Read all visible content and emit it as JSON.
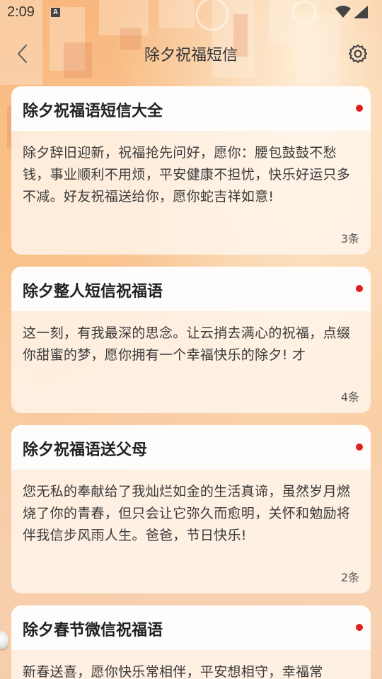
{
  "status_bar": {
    "time": "2:09",
    "notification_icon": "A"
  },
  "app_bar": {
    "title": "除夕祝福短信",
    "back_icon": "chevron-left-icon",
    "settings_icon": "gear-icon"
  },
  "cards": [
    {
      "title": "除夕祝福语短信大全",
      "text": "除夕辞旧迎新，祝福抢先问好，愿你：腰包鼓鼓不愁钱，事业顺利不用烦，平安健康不担忧，快乐好运只多不减。好友祝福送给你，愿你蛇吉祥如意!",
      "count": "3条"
    },
    {
      "title": "除夕整人短信祝福语",
      "text": "这一刻，有我最深的思念。让云捎去满心的祝福，点缀你甜蜜的梦，愿你拥有一个幸福快乐的除夕! 才",
      "count": "4条"
    },
    {
      "title": "除夕祝福语送父母",
      "text": "您无私的奉献给了我灿烂如金的生活真谛，虽然岁月燃烧了你的青春，但只会让它弥久而愈明，关怀和勉励将伴我信步风雨人生。爸爸，节日快乐!",
      "count": "2条"
    },
    {
      "title": "除夕春节微信祝福语",
      "text": "新春送喜，愿你快乐常相伴，平安想相守，幸福常",
      "count": ""
    }
  ],
  "colors": {
    "unread_dot": "#e0201c",
    "card_header": "#fffdfb",
    "background_accent": "#f6b27a"
  }
}
